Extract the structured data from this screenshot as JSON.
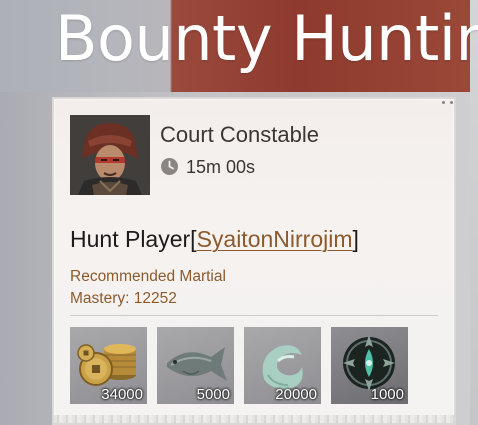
{
  "header": {
    "title": "Bounty Huntin"
  },
  "bounty": {
    "npc_name": "Court Constable",
    "timer": "15m 00s",
    "mission_prefix": "Hunt Player[",
    "target": "SyaitonNirrojim",
    "mission_suffix": "]",
    "requirement_line1": "Recommended Martial",
    "requirement_line2": "Mastery: 12252"
  },
  "rewards": [
    {
      "icon": "coins-icon",
      "amount": "34000"
    },
    {
      "icon": "fish-icon",
      "amount": "5000"
    },
    {
      "icon": "jade-swirl-icon",
      "amount": "20000"
    },
    {
      "icon": "emblem-icon",
      "amount": "1000"
    }
  ],
  "colors": {
    "accent_brown": "#8c5a2c",
    "title_white": "#ffffff",
    "text_dark": "#1e1b1a"
  }
}
